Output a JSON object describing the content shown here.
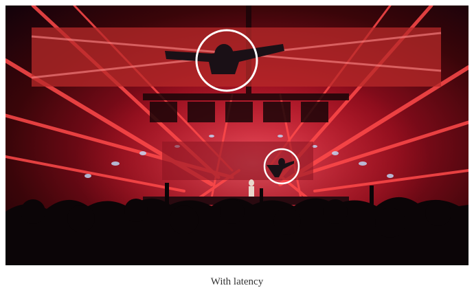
{
  "figure": {
    "caption": "With latency"
  },
  "colors": {
    "stage_red": "#c81830",
    "beam": "#ff5a5a",
    "highlight_ring": "#ffffff",
    "caption_text": "#333333"
  }
}
